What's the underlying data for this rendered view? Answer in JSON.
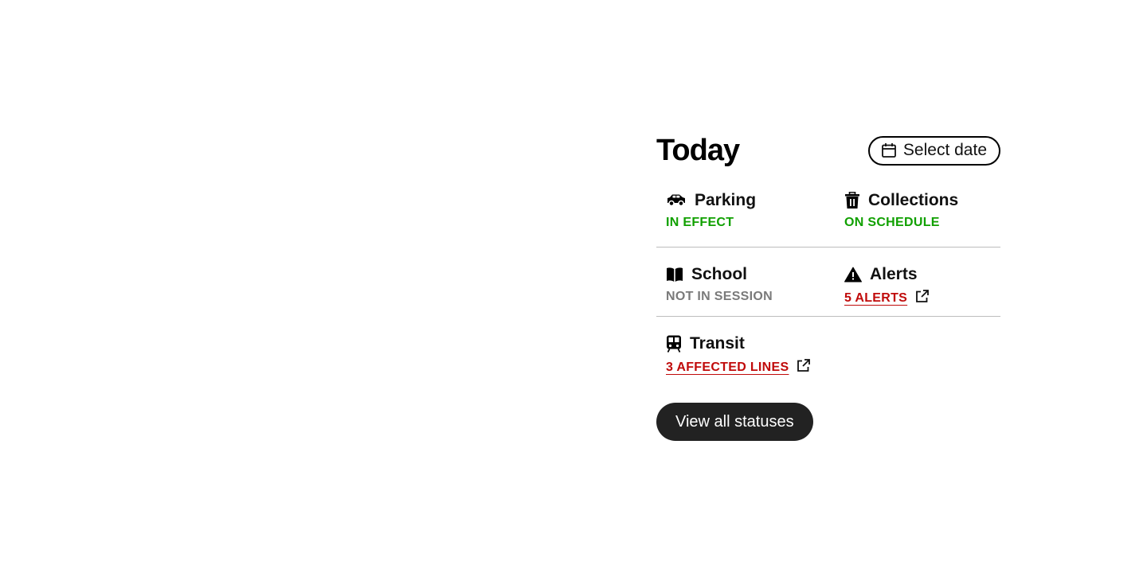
{
  "header": {
    "title": "Today",
    "date_button_label": "Select date",
    "date_button_icon": "calendar-icon"
  },
  "statuses": [
    {
      "title": "Parking",
      "icon": "car-icon",
      "status": "IN EFFECT",
      "status_color": "#10a000"
    },
    {
      "title": "Collections",
      "icon": "trash-icon",
      "status": "ON SCHEDULE",
      "status_color": "#10a000"
    },
    {
      "title": "School",
      "icon": "book-icon",
      "status": "NOT IN SESSION",
      "status_color": "#7a7a7a"
    },
    {
      "title": "Alerts",
      "icon": "warning-icon",
      "status": "5 ALERTS",
      "status_color": "#c00a0a",
      "link_icon": "external-link-icon"
    },
    {
      "title": "Transit",
      "icon": "train-icon",
      "status": "3 AFFECTED LINES",
      "status_color": "#c00a0a",
      "link_icon": "external-link-icon"
    }
  ],
  "footer": {
    "view_all_label": "View all statuses"
  }
}
